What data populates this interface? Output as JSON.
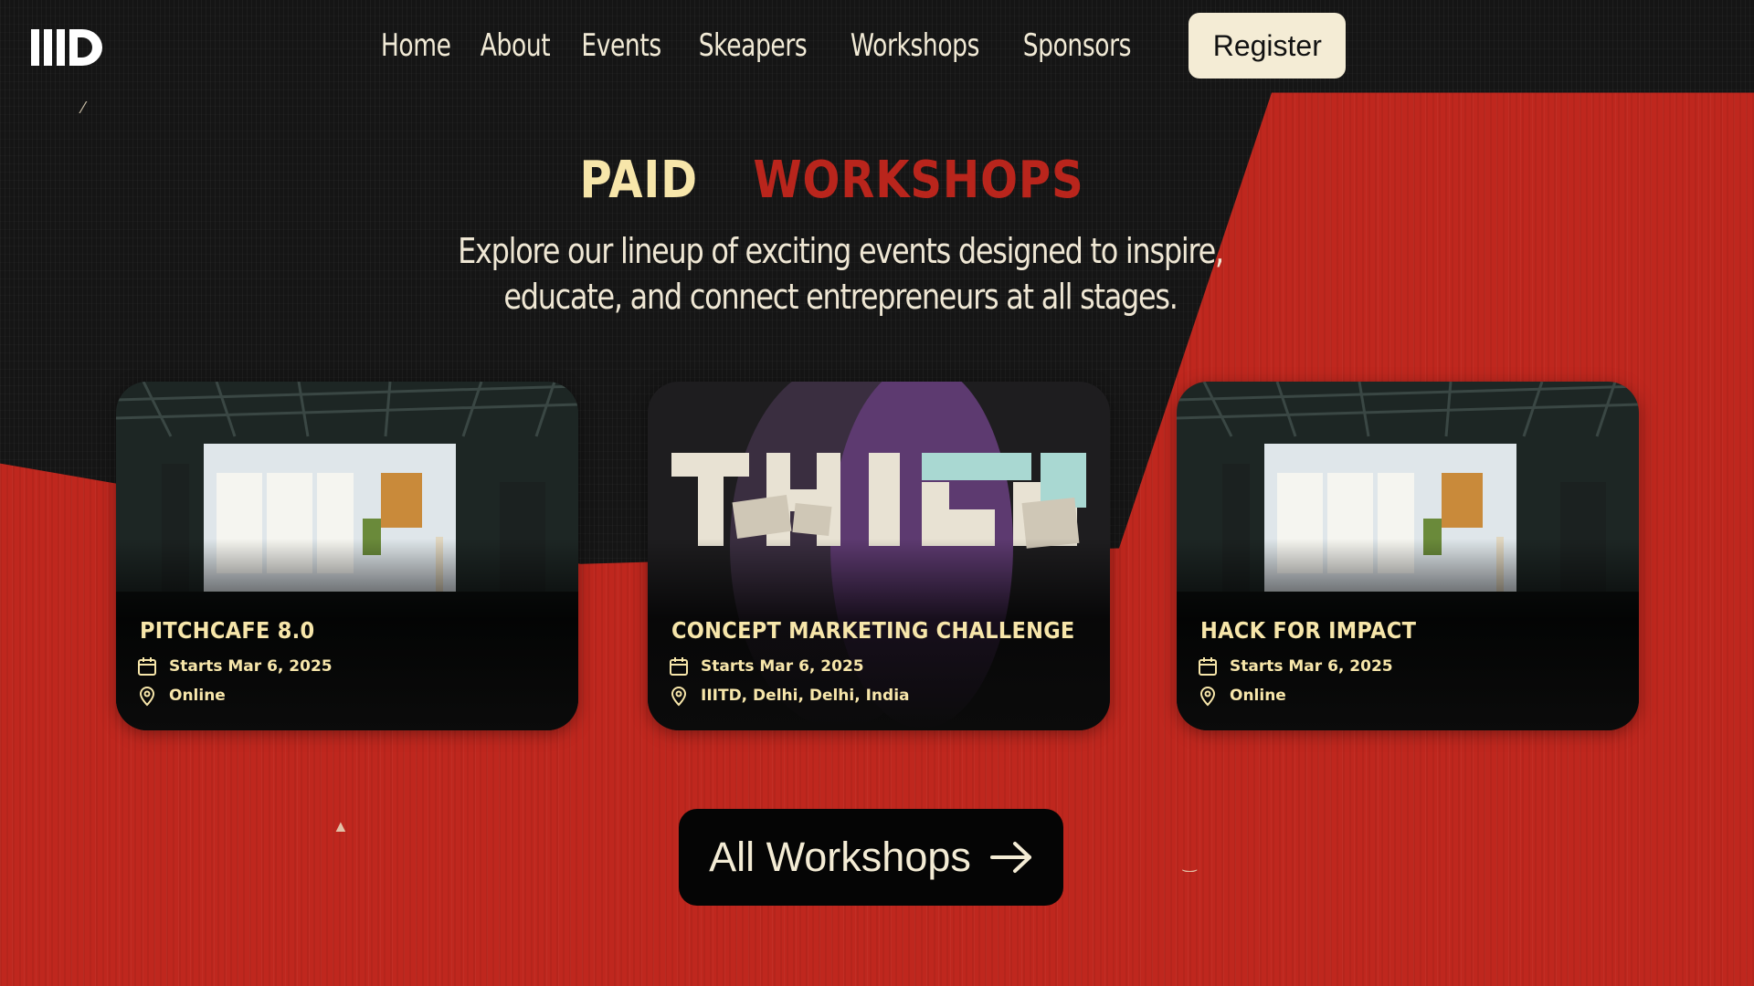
{
  "nav": {
    "logo_alt": "IIIT-D logo",
    "links": [
      {
        "label": "Home"
      },
      {
        "label": "About"
      },
      {
        "label": "Events"
      },
      {
        "label": "Skeapers"
      },
      {
        "label": "Workshops"
      },
      {
        "label": "Sponsors"
      }
    ],
    "register_label": "Register"
  },
  "hero": {
    "title_part1": "PAID",
    "title_part2": "WORKSHOPS",
    "subtitle": "Explore our lineup of exciting events designed to inspire, educate, and connect entrepreneurs at all stages."
  },
  "workshops": [
    {
      "title": "PITCHCAFE 8.0",
      "date": "Starts Mar 6, 2025",
      "location": "Online",
      "image": "stage-presentation"
    },
    {
      "title": "CONCEPT MARKETING CHALLENGE",
      "date": "Starts Mar 6, 2025",
      "location": "IIITD, Delhi, Delhi, India",
      "image": "think-lettering"
    },
    {
      "title": "HACK FOR IMPACT",
      "date": "Starts Mar 6, 2025",
      "location": "Online",
      "image": "stage-presentation"
    }
  ],
  "cta": {
    "label": "All Workshops",
    "icon": "arrow-right-icon"
  },
  "colors": {
    "red": "#bf271e",
    "dark": "#151515",
    "cream": "#f4ecd5",
    "gold": "#f7e6aa"
  }
}
